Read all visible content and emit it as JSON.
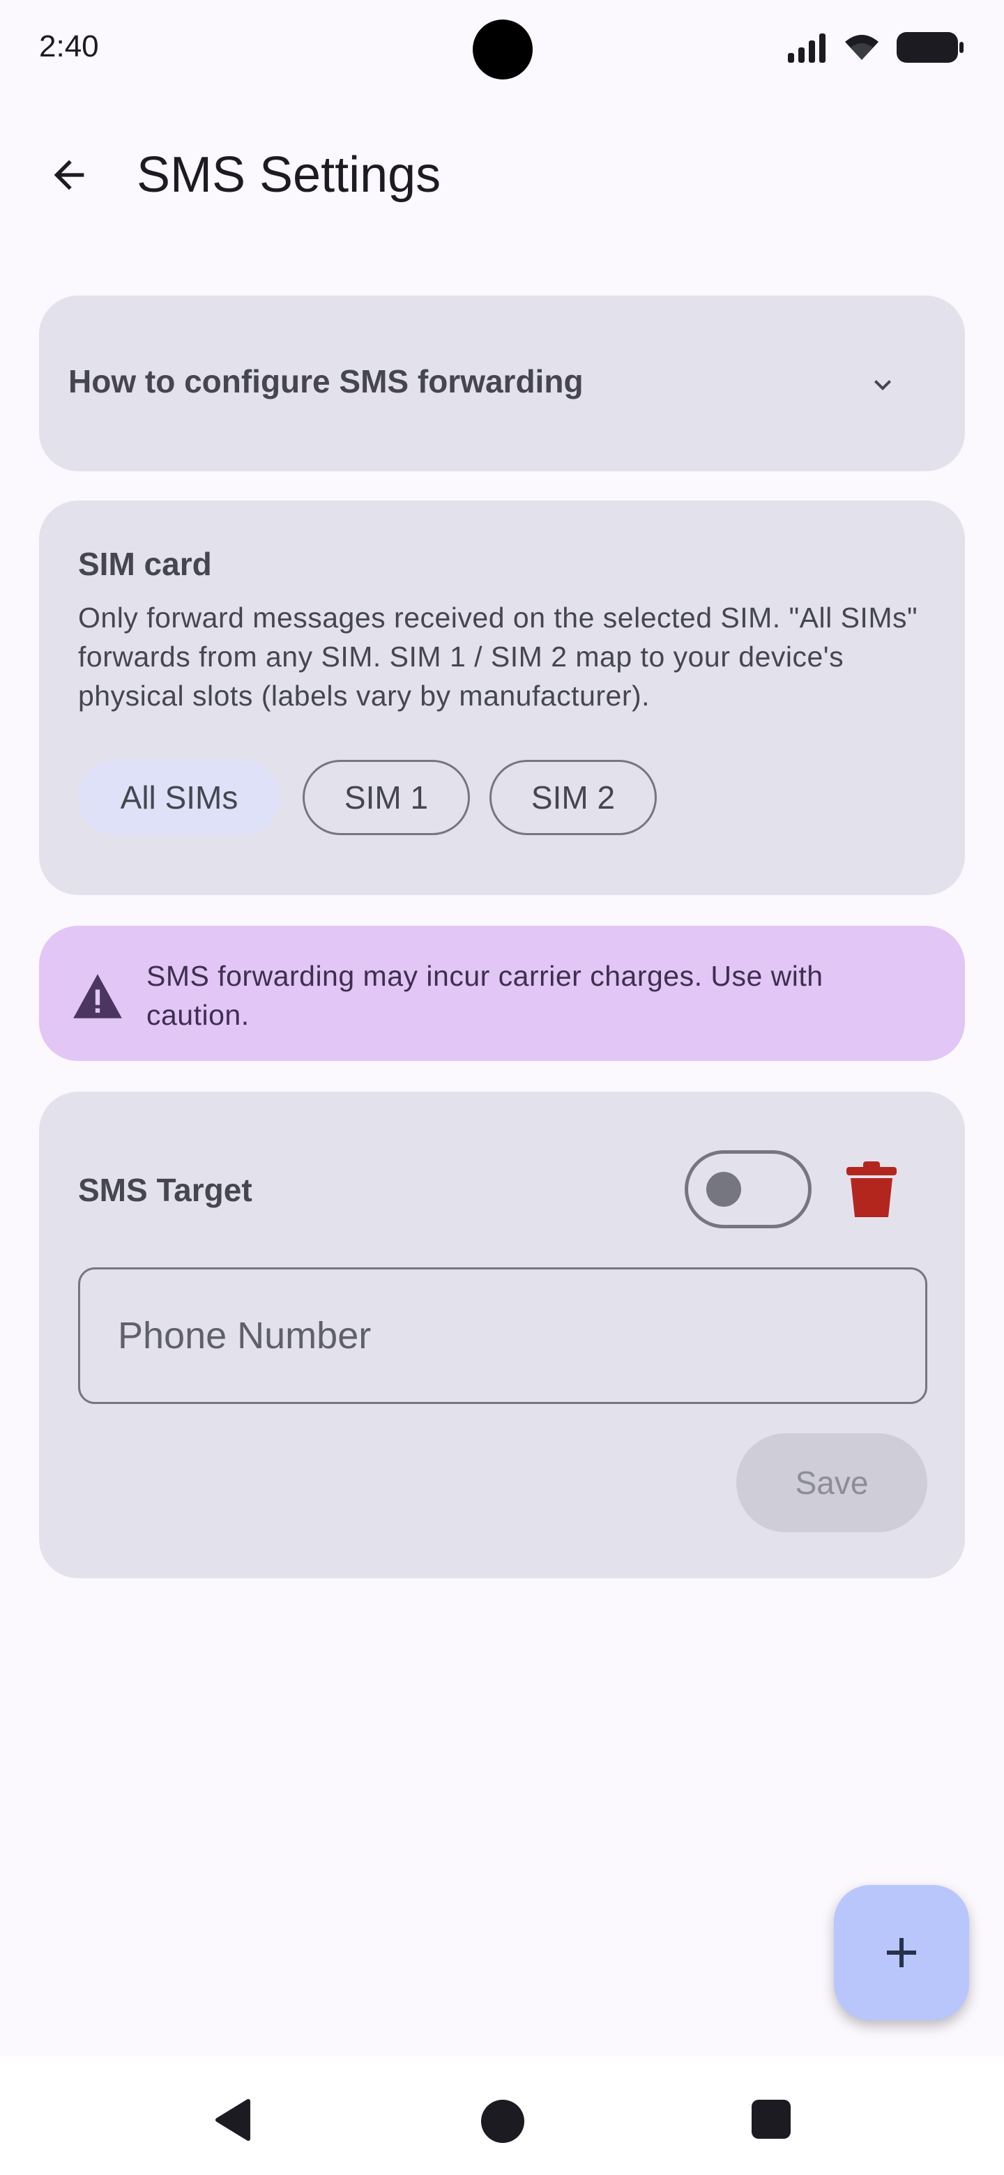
{
  "status_bar": {
    "time": "2:40"
  },
  "app_bar": {
    "title": "SMS Settings"
  },
  "help": {
    "title": "How to configure SMS forwarding"
  },
  "sim_card": {
    "title": "SIM card",
    "description": "Only forward messages received on the selected SIM. \"All SIMs\" forwards from any SIM. SIM 1 / SIM 2 map to your device's physical slots (labels vary by manufacturer).",
    "options": [
      "All SIMs",
      "SIM 1",
      "SIM 2"
    ],
    "selected": "All SIMs"
  },
  "warning": {
    "text": "SMS forwarding may incur carrier charges. Use with caution."
  },
  "target": {
    "title": "SMS Target",
    "enabled": false,
    "phone_value": "",
    "phone_placeholder": "Phone Number",
    "save_label": "Save"
  },
  "colors": {
    "background": "#fbf8fe",
    "card": "#e3e2ec",
    "selected_chip": "#dfe1f9",
    "warning_bg": "#e2c6f5",
    "delete_red": "#b3261e",
    "fab": "#b9c6fb"
  },
  "icons": {
    "back": "arrow-left-icon",
    "expand": "chevron-down-icon",
    "warning": "warning-triangle-icon",
    "delete": "trash-icon",
    "add": "plus-icon"
  }
}
